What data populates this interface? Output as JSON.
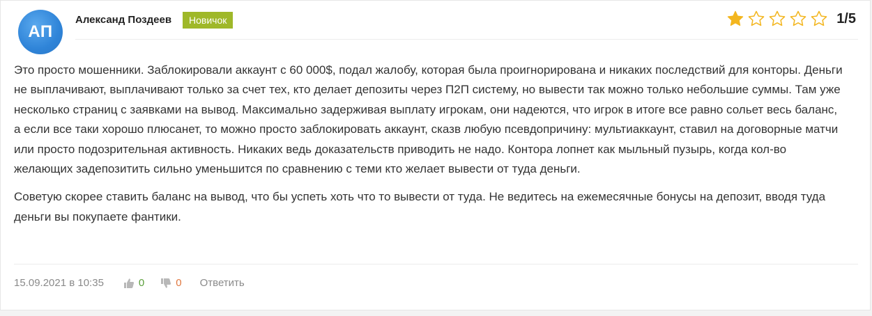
{
  "author": {
    "initials": "АП",
    "name": "Александ Поздеев",
    "badge": "Новичок",
    "badge_color": "#9fb829",
    "avatar_color": "#3b8fe0"
  },
  "rating": {
    "value": 1,
    "max": 5,
    "text": "1/5",
    "star_color": "#f3b61f"
  },
  "review": {
    "paragraphs": [
      "Это просто мошенники. Заблокировали аккаунт с 60 000$, подал жалобу, которая была проигнорирована и никаких последствий для конторы. Деньги не выплачивают, выплачивают только за счет тех, кто делает депозиты через П2П систему, но вывести так можно только небольшие суммы. Там уже несколько страниц с заявками на вывод. Максимально задерживая выплату игрокам, они надеются, что игрок в итоге все равно сольет весь баланс, а если все таки хорошо плюсанет, то можно просто заблокировать аккаунт, сказв любую псевдопричину: мультиаккаунт, ставил на договорные матчи или просто подозрительная активность. Никаких ведь доказательств приводить не надо. Контора лопнет как мыльный пузырь, когда кол-во желающих задепозитить сильно уменьшится по сравнению с теми кто желает вывести от туда деньги.",
      "Советую скорее ставить баланс на вывод, что бы успеть хоть что то вывести от туда. Не ведитесь на ежемесячные бонусы на депозит, вводя туда деньги вы покупаете фантики."
    ]
  },
  "footer": {
    "date": "15.09.2021 в 10:35",
    "likes": "0",
    "dislikes": "0",
    "reply_label": "Ответить",
    "like_icon": "thumbs-up-icon",
    "dislike_icon": "thumbs-down-icon"
  }
}
